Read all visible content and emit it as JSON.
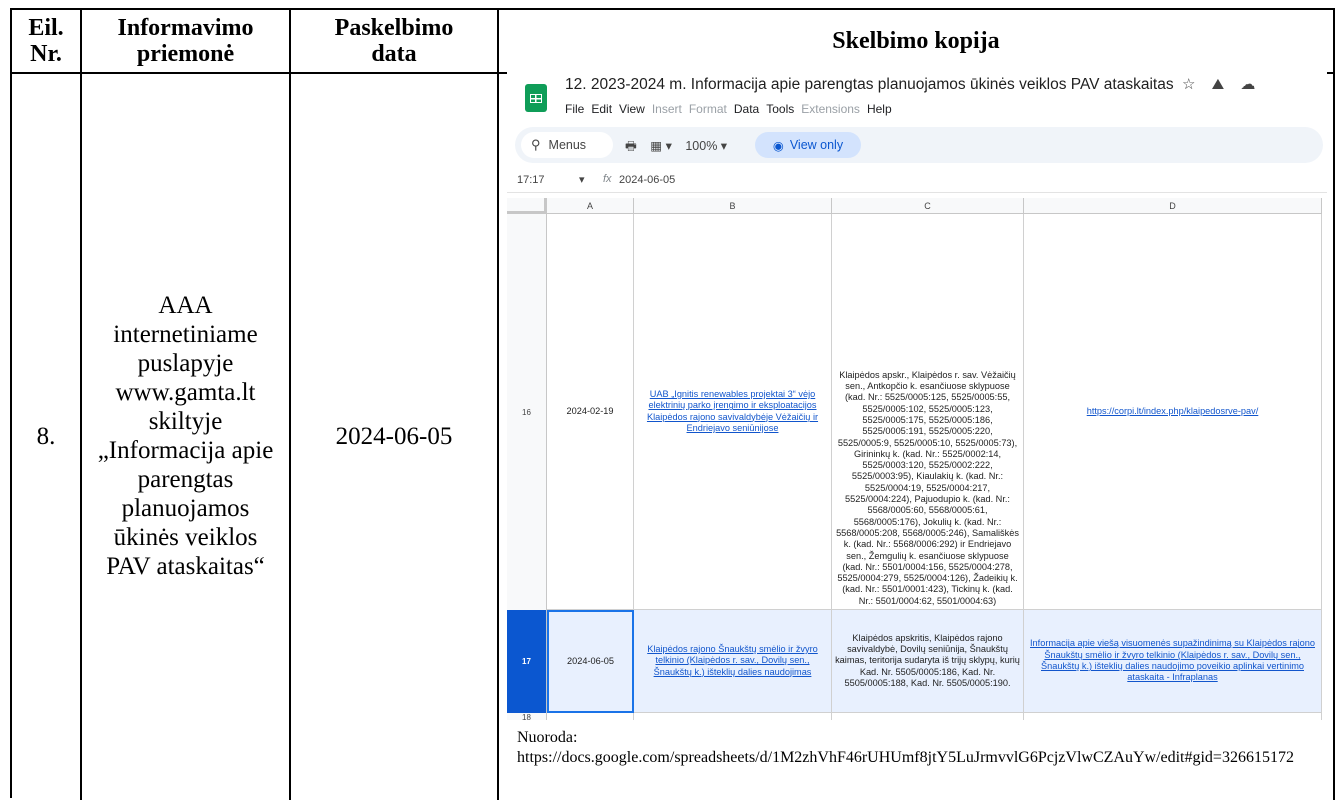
{
  "table": {
    "headers": {
      "nr": "Eil. Nr.",
      "priemone": "Informavimo priemonė",
      "data": "Paskelbimo data",
      "kopija": "Skelbimo kopija"
    },
    "row": {
      "nr": "8.",
      "priemone": "AAA internetiniame puslapyje www.gamta.lt skiltyje „Informacija apie parengtas planuojamos ūkinės veiklos PAV ataskaitas“",
      "data": "2024-06-05"
    }
  },
  "sheet": {
    "title": "12. 2023-2024 m. Informacija apie parengtas planuojamos ūkinės veiklos PAV ataskaitas",
    "title_icons": "☆ ⛰ ☁",
    "menu": [
      {
        "label": "File",
        "dim": false
      },
      {
        "label": "Edit",
        "dim": false
      },
      {
        "label": "View",
        "dim": false
      },
      {
        "label": "Insert",
        "dim": true
      },
      {
        "label": "Format",
        "dim": true
      },
      {
        "label": "Data",
        "dim": false
      },
      {
        "label": "Tools",
        "dim": false
      },
      {
        "label": "Extensions",
        "dim": true
      },
      {
        "label": "Help",
        "dim": false
      }
    ],
    "search_label": "Menus",
    "zoom": "100%",
    "view_only": "View only",
    "cell_ref": "17:17",
    "formula_value": "2024-06-05",
    "columns": [
      "A",
      "B",
      "C",
      "D"
    ],
    "rows": [
      {
        "num": "16",
        "a": "2024-02-19",
        "b": "UAB „Ignitis renewables projektai 3“ vėjo elektrinių parko įrengimo ir eksploatacijos Klaipėdos rajono savivaldybėje Vėžaičių ir Endriejavo seniūnijose",
        "c": "Klaipėdos apskr., Klaipėdos r. sav. Vėžaičių sen., Antkopčio k. esančiuose sklypuose (kad. Nr.: 5525/0005:125, 5525/0005:55, 5525/0005:102, 5525/0005:123, 5525/0005:175, 5525/0005:186, 5525/0005:191, 5525/0005:220, 5525/0005:9, 5525/0005:10, 5525/0005:73), Girininkų k. (kad. Nr.: 5525/0002:14, 5525/0003:120, 5525/0002:222, 5525/0003:95), Kiaulakių k. (kad. Nr.: 5525/0004:19, 5525/0004:217, 5525/0004:224), Pajuodupio k. (kad. Nr.: 5568/0005:60, 5568/0005:61, 5568/0005:176), Jokulių k. (kad. Nr.: 5568/0005:208, 5568/0005:246), Samališkės k. (kad. Nr.: 5568/0006:292) ir Endriejavo sen., Žemgulių k. esančiuose sklypuose (kad. Nr.: 5501/0004:156, 5525/0004:278, 5525/0004:279, 5525/0004:126), Žadeikių k. (kad. Nr.: 5501/0001:423), Tickinų k. (kad. Nr.: 5501/0004:62, 5501/0004:63)",
        "d": "https://corpi.lt/index.php/klaipedosrve-pav/"
      },
      {
        "num": "17",
        "a": "2024-06-05",
        "b": "Klaipėdos rajono Šnaukštų smėlio ir žvyro telkinio (Klaipėdos r. sav., Dovilų sen., Šnaukštų k.) išteklių dalies naudojimas",
        "c": "Klaipėdos apskritis, Klaipėdos rajono savivaldybė, Dovilų seniūnija, Šnaukštų kaimas, teritorija sudaryta iš trijų sklypų, kurių Kad. Nr. 5505/0005:186, Kad. Nr. 5505/0005:188, Kad. Nr. 5505/0005:190.",
        "d": "Informacija apie viešą visuomenės supažindinimą su Klaipėdos rajono Šnaukštų smėlio ir žvyro telkinio (Klaipėdos r. sav., Dovilų sen., Šnaukštų k.) išteklių dalies naudojimo poveikio aplinkai vertinimo ataskaita - Infraplanas"
      },
      {
        "num": "18",
        "a": "",
        "b": "",
        "c": "",
        "d": ""
      }
    ]
  },
  "footer": {
    "label": "Nuoroda:",
    "url": "https://docs.google.com/spreadsheets/d/1M2zhVhF46rUHUmf8jtY5LuJrmvvlG6PcjzVlwCZAuYw/edit#gid=326615172"
  }
}
